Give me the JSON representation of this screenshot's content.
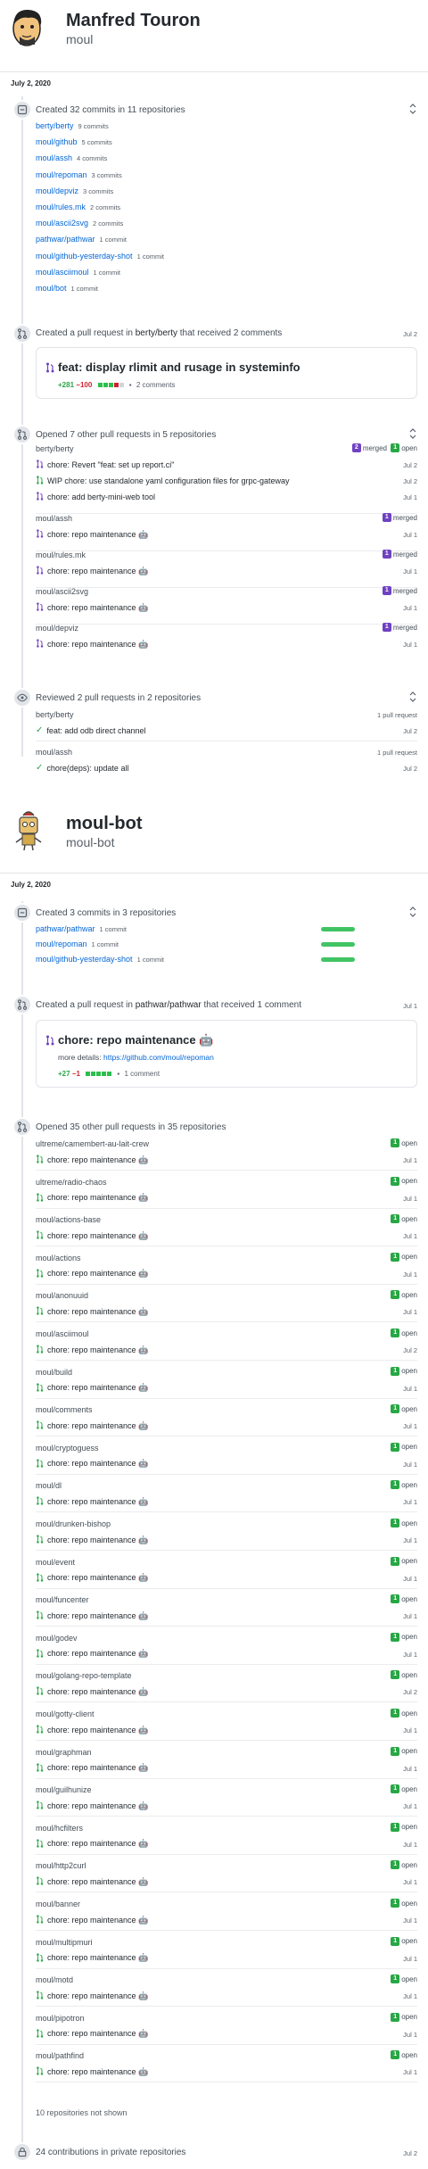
{
  "users": [
    {
      "name": "Manfred Touron",
      "login": "moul",
      "date": "July 2, 2020",
      "commits": {
        "title": "Created 32 commits in 11 repositories",
        "repos": [
          {
            "repo": "berty/berty",
            "count": "9 commits"
          },
          {
            "repo": "moul/github",
            "count": "5 commits"
          },
          {
            "repo": "moul/assh",
            "count": "4 commits"
          },
          {
            "repo": "moul/repoman",
            "count": "3 commits"
          },
          {
            "repo": "moul/depviz",
            "count": "3 commits"
          },
          {
            "repo": "moul/rules.mk",
            "count": "2 commits"
          },
          {
            "repo": "moul/ascii2svg",
            "count": "2 commits"
          },
          {
            "repo": "pathwar/pathwar",
            "count": "1 commit"
          },
          {
            "repo": "moul/github-yesterday-shot",
            "count": "1 commit"
          },
          {
            "repo": "moul/asciimoul",
            "count": "1 commit"
          },
          {
            "repo": "moul/bot",
            "count": "1 commit"
          }
        ]
      },
      "pr_created": {
        "title_prefix": "Created a pull request in",
        "repo": "berty/berty",
        "title_suffix": "that received 2 comments",
        "date": "Jul 2",
        "pr_title": "feat: display rlimit and rusage in systeminfo",
        "additions": "+281",
        "deletions": "−100",
        "comments": "2 comments"
      },
      "opened_prs": {
        "title": "Opened 7 other pull requests in 5 repositories",
        "groups": [
          {
            "repo": "berty/berty",
            "merged": "2",
            "merged_label": "merged",
            "open": "1",
            "open_label": "open",
            "items": [
              {
                "title": "chore: Revert \"feat: set up report.ci\"",
                "date": "Jul 2",
                "state": "merged"
              },
              {
                "title": "WIP chore: use standalone yaml configuration files for grpc-gateway",
                "date": "Jul 2",
                "state": "open"
              },
              {
                "title": "chore: add berty-mini-web tool",
                "date": "Jul 1",
                "state": "merged"
              }
            ]
          },
          {
            "repo": "moul/assh",
            "merged": "1",
            "merged_label": "merged",
            "items": [
              {
                "title": "chore: repo maintenance 🤖",
                "date": "Jul 1",
                "state": "merged"
              }
            ]
          },
          {
            "repo": "moul/rules.mk",
            "merged": "1",
            "merged_label": "merged",
            "items": [
              {
                "title": "chore: repo maintenance 🤖",
                "date": "Jul 1",
                "state": "merged"
              }
            ]
          },
          {
            "repo": "moul/ascii2svg",
            "merged": "1",
            "merged_label": "merged",
            "items": [
              {
                "title": "chore: repo maintenance 🤖",
                "date": "Jul 1",
                "state": "merged"
              }
            ]
          },
          {
            "repo": "moul/depviz",
            "merged": "1",
            "merged_label": "merged",
            "items": [
              {
                "title": "chore: repo maintenance 🤖",
                "date": "Jul 1",
                "state": "merged"
              }
            ]
          }
        ]
      },
      "reviewed": {
        "title": "Reviewed 2 pull requests in 2 repositories",
        "groups": [
          {
            "repo": "berty/berty",
            "count": "1 pull request",
            "item": "feat: add odb direct channel",
            "date": "Jul 2"
          },
          {
            "repo": "moul/assh",
            "count": "1 pull request",
            "item": "chore(deps): update all",
            "date": "Jul 2"
          }
        ]
      }
    },
    {
      "name": "moul-bot",
      "login": "moul-bot",
      "date": "July 2, 2020",
      "commits": {
        "title": "Created 3 commits in 3 repositories",
        "repos": [
          {
            "repo": "pathwar/pathwar",
            "count": "1 commit"
          },
          {
            "repo": "moul/repoman",
            "count": "1 commit"
          },
          {
            "repo": "moul/github-yesterday-shot",
            "count": "1 commit"
          }
        ]
      },
      "pr_created": {
        "title_prefix": "Created a pull request in",
        "repo": "pathwar/pathwar",
        "title_suffix": "that received 1 comment",
        "date": "Jul 1",
        "pr_title": "chore: repo maintenance 🤖",
        "details_label": "more details:",
        "details_link": "https://github.com/moul/repoman",
        "additions": "+27",
        "deletions": "−1",
        "comments": "1 comment"
      },
      "opened_prs": {
        "title": "Opened 35 other pull requests in 35 repositories",
        "item_title": "chore: repo maintenance 🤖",
        "open_count": "1",
        "open_label": "open",
        "groups": [
          {
            "repo": "ultreme/camembert-au-lait-crew",
            "date": "Jul 1"
          },
          {
            "repo": "ultreme/radio-chaos",
            "date": "Jul 1"
          },
          {
            "repo": "moul/actions-base",
            "date": "Jul 1"
          },
          {
            "repo": "moul/actions",
            "date": "Jul 1"
          },
          {
            "repo": "moul/anonuuid",
            "date": "Jul 1"
          },
          {
            "repo": "moul/asciimoul",
            "date": "Jul 2"
          },
          {
            "repo": "moul/build",
            "date": "Jul 1"
          },
          {
            "repo": "moul/comments",
            "date": "Jul 1"
          },
          {
            "repo": "moul/cryptoguess",
            "date": "Jul 1"
          },
          {
            "repo": "moul/dl",
            "date": "Jul 1"
          },
          {
            "repo": "moul/drunken-bishop",
            "date": "Jul 1"
          },
          {
            "repo": "moul/event",
            "date": "Jul 1"
          },
          {
            "repo": "moul/funcenter",
            "date": "Jul 1"
          },
          {
            "repo": "moul/godev",
            "date": "Jul 1"
          },
          {
            "repo": "moul/golang-repo-template",
            "date": "Jul 2"
          },
          {
            "repo": "moul/gotty-client",
            "date": "Jul 1"
          },
          {
            "repo": "moul/graphman",
            "date": "Jul 1"
          },
          {
            "repo": "moul/guilhunize",
            "date": "Jul 1"
          },
          {
            "repo": "moul/hcfilters",
            "date": "Jul 1"
          },
          {
            "repo": "moul/http2curl",
            "date": "Jul 1"
          },
          {
            "repo": "moul/banner",
            "date": "Jul 1"
          },
          {
            "repo": "moul/multipmuri",
            "date": "Jul 1"
          },
          {
            "repo": "moul/motd",
            "date": "Jul 1"
          },
          {
            "repo": "moul/pipotron",
            "date": "Jul 1"
          },
          {
            "repo": "moul/pathfind",
            "date": "Jul 1"
          }
        ],
        "not_shown": "10 repositories not shown"
      },
      "private": {
        "title": "24 contributions in private repositories",
        "date": "Jul 2"
      }
    }
  ]
}
